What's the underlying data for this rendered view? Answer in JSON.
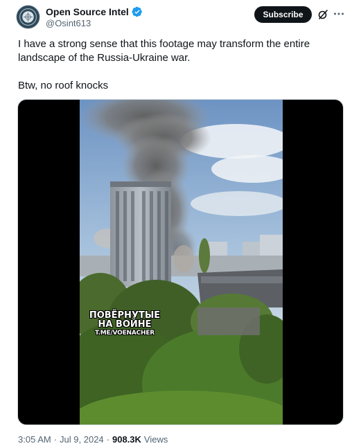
{
  "author": {
    "display_name": "Open Source Intel",
    "handle": "@Osint613",
    "avatar_icon": "circular-seal-avatar",
    "verified_icon": "verified-badge-icon",
    "verified_color": "#1d9bf0"
  },
  "actions": {
    "subscribe_label": "Subscribe",
    "grok_icon": "slashed-circle-icon",
    "more_icon": "more-dots-icon"
  },
  "tweet": {
    "text_line1": "I have a strong sense that this footage may transform the entire landscape of the Russia-Ukraine war.",
    "text_line2": "Btw, no roof knocks"
  },
  "media": {
    "watermark_line1": "ПОВЁРНУТЫЕ",
    "watermark_line2": "НА ВОЙНЕ",
    "watermark_line3": "T.ME/VOENACHER"
  },
  "footer": {
    "time": "3:05 AM",
    "separator1": "·",
    "date": "Jul 9, 2024",
    "separator2": "·",
    "views_count": "908.3K",
    "views_label": "Views"
  }
}
